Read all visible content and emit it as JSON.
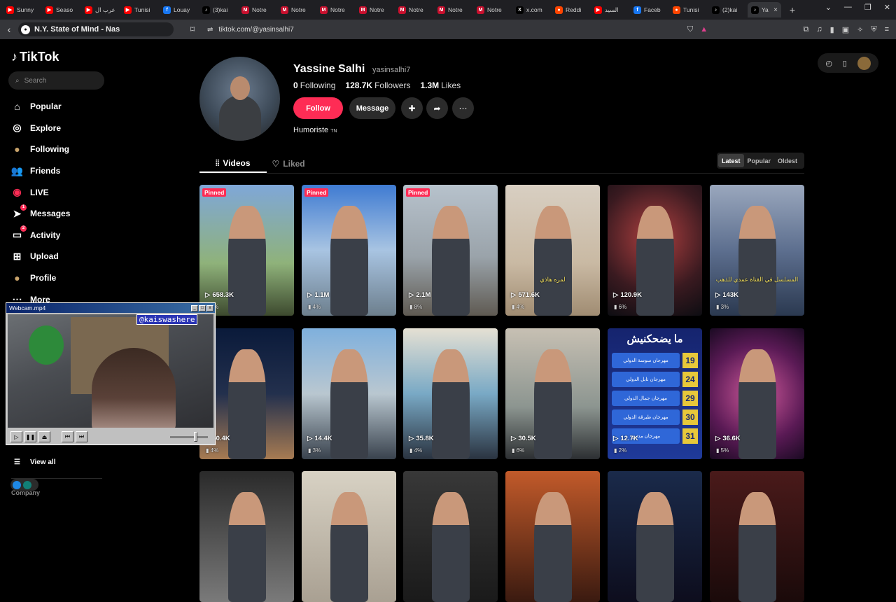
{
  "browser": {
    "tabs": [
      {
        "label": "Sunny",
        "color": "#ff0000",
        "glyph": "▶"
      },
      {
        "label": "Seaso",
        "color": "#ff0000",
        "glyph": "▶"
      },
      {
        "label": "عرب ال",
        "color": "#ff0000",
        "glyph": "▶"
      },
      {
        "label": "Tunisi",
        "color": "#ff0000",
        "glyph": "▶"
      },
      {
        "label": "Louay",
        "color": "#1877f2",
        "glyph": "f"
      },
      {
        "label": "(3)kai",
        "color": "#000000",
        "glyph": "♪"
      },
      {
        "label": "Notre",
        "color": "#c8102e",
        "glyph": "M"
      },
      {
        "label": "Notre",
        "color": "#c8102e",
        "glyph": "M"
      },
      {
        "label": "Notre",
        "color": "#c8102e",
        "glyph": "M"
      },
      {
        "label": "Notre",
        "color": "#c8102e",
        "glyph": "M"
      },
      {
        "label": "Notre",
        "color": "#c8102e",
        "glyph": "M"
      },
      {
        "label": "Notre",
        "color": "#c8102e",
        "glyph": "M"
      },
      {
        "label": "Notre",
        "color": "#c8102e",
        "glyph": "M"
      },
      {
        "label": "x.com",
        "color": "#000000",
        "glyph": "X"
      },
      {
        "label": "Reddi",
        "color": "#ff4500",
        "glyph": "●"
      },
      {
        "label": "السيد",
        "color": "#ff0000",
        "glyph": "▶"
      },
      {
        "label": "Faceb",
        "color": "#1877f2",
        "glyph": "f"
      },
      {
        "label": "Tunisi",
        "color": "#ff4500",
        "glyph": "●"
      },
      {
        "label": "(2)kai",
        "color": "#000000",
        "glyph": "♪"
      }
    ],
    "active_tab": "Ya",
    "media_title": "N.Y. State of Mind - Nas",
    "url": "tiktok.com/@yasinsalhi7"
  },
  "sidebar": {
    "logo": "TikTok",
    "search_placeholder": "Search",
    "items": [
      {
        "label": "Popular",
        "icon": "home-icon",
        "glyph": "⌂"
      },
      {
        "label": "Explore",
        "icon": "compass-icon",
        "glyph": "◎"
      },
      {
        "label": "Following",
        "icon": "following-avatar-icon",
        "glyph": "●"
      },
      {
        "label": "Friends",
        "icon": "friends-icon",
        "glyph": "👥"
      },
      {
        "label": "LIVE",
        "icon": "live-icon",
        "glyph": "◉"
      },
      {
        "label": "Messages",
        "icon": "paper-plane-icon",
        "glyph": "➤",
        "badge": "1"
      },
      {
        "label": "Activity",
        "icon": "inbox-icon",
        "glyph": "▭",
        "badge": "2"
      },
      {
        "label": "Upload",
        "icon": "plus-square-icon",
        "glyph": "⊞"
      },
      {
        "label": "Profile",
        "icon": "profile-avatar-icon",
        "glyph": "●"
      },
      {
        "label": "More",
        "icon": "more-icon",
        "glyph": "⋯"
      }
    ],
    "view_all": "View all",
    "company": "Company"
  },
  "webcam": {
    "title": "Webcam.mp4",
    "handle": "@kaiswashere"
  },
  "profile": {
    "name": "Yassine Salhi",
    "username": "yasinsalhi7",
    "following_count": "0",
    "following_label": "Following",
    "followers_count": "128.7K",
    "followers_label": "Followers",
    "likes_count": "1.3M",
    "likes_label": "Likes",
    "follow_label": "Follow",
    "message_label": "Message",
    "bio": "Humoriste",
    "bio_flag": "TN"
  },
  "tabs": {
    "videos": "Videos",
    "liked": "Liked"
  },
  "sort": {
    "latest": "Latest",
    "popular": "Popular",
    "oldest": "Oldest"
  },
  "videos": [
    {
      "views": "658.3K",
      "pct": "5%",
      "pinned": "Pinned",
      "bg": "linear-gradient(180deg,#7fa7d8 0%,#8fb27a 60%,#3d4a2f 100%)",
      "caption": ""
    },
    {
      "views": "1.1M",
      "pct": "4%",
      "pinned": "Pinned",
      "bg": "linear-gradient(180deg,#3f7bd2 0%,#a8c4e2 50%,#6d7f8d 100%)",
      "caption": ""
    },
    {
      "views": "2.1M",
      "pct": "8%",
      "pinned": "Pinned",
      "bg": "linear-gradient(180deg,#b7c2cc 0%,#9aa3aa 55%,#5f5a52 100%)",
      "caption": ""
    },
    {
      "views": "571.6K",
      "pct": "4%",
      "pinned": "",
      "bg": "linear-gradient(180deg,#d8cfc2 0%,#c9b9a3 60%,#a08c72 100%)",
      "caption": "لمره هاذي"
    },
    {
      "views": "120.9K",
      "pct": "6%",
      "pinned": "",
      "bg": "radial-gradient(circle at 50% 40%,#b04040 0%,#3a1a20 60%,#0d0d12 100%)",
      "caption": ""
    },
    {
      "views": "143K",
      "pct": "3%",
      "pinned": "",
      "bg": "linear-gradient(180deg,#9aa7bd 0%,#5d6f8f 50%,#2b3950 100%)",
      "caption": "المسلسل في القناة عمدي للذهب"
    },
    {
      "views": "50.4K",
      "pct": "4%",
      "pinned": "",
      "bg": "linear-gradient(180deg,#0a1a3a 0%,#23304d 50%,#a77b52 100%)",
      "caption": ""
    },
    {
      "views": "14.4K",
      "pct": "3%",
      "pinned": "",
      "bg": "linear-gradient(180deg,#7fb0dd 0%,#b9c7d0 50%,#39424d 100%)",
      "caption": ""
    },
    {
      "views": "35.8K",
      "pct": "4%",
      "pinned": "",
      "bg": "linear-gradient(180deg,#e5e0d3 0%,#79a9c5 50%,#2a3340 100%)",
      "caption": ""
    },
    {
      "views": "30.5K",
      "pct": "6%",
      "pinned": "",
      "bg": "linear-gradient(180deg,#c7c0b3 0%,#8c9590 60%,#2c2f32 100%)",
      "caption": ""
    },
    {
      "views": "12.7K",
      "pct": "2%",
      "pinned": "",
      "bg": "linear-gradient(180deg,#16246e 0%,#1f3a9a 100%)",
      "caption": "",
      "poster": true
    },
    {
      "views": "36.6K",
      "pct": "5%",
      "pinned": "",
      "bg": "radial-gradient(circle at 50% 50%,#d05a9b 0%,#5a1a55 60%,#1a0a22 100%)",
      "caption": ""
    },
    {
      "views": "",
      "pct": "",
      "pinned": "",
      "bg": "linear-gradient(180deg,#2a2a2a,#7a7a7a)",
      "caption": ""
    },
    {
      "views": "",
      "pct": "",
      "pinned": "",
      "bg": "linear-gradient(180deg,#d8d2c4,#a9a092)",
      "caption": ""
    },
    {
      "views": "",
      "pct": "",
      "pinned": "",
      "bg": "linear-gradient(180deg,#383838,#1a1a1a)",
      "caption": ""
    },
    {
      "views": "",
      "pct": "",
      "pinned": "",
      "bg": "linear-gradient(180deg,#c25a2a,#3a1a10)",
      "caption": ""
    },
    {
      "views": "",
      "pct": "",
      "pinned": "",
      "bg": "linear-gradient(180deg,#1a2a4a,#0d0d1d)",
      "caption": ""
    },
    {
      "views": "",
      "pct": "",
      "pinned": "",
      "bg": "linear-gradient(180deg,#4a1a1a,#1a0a0a)",
      "caption": ""
    }
  ],
  "poster": {
    "heading": "ما يضحكنيش",
    "rows": [
      {
        "label": "مهرجان سوسة الدولي",
        "num": "19"
      },
      {
        "label": "مهرجان نابل الدولي",
        "num": "24"
      },
      {
        "label": "مهرجان جمال الدولي",
        "num": "29"
      },
      {
        "label": "مهرجان طبرقة الدولي",
        "num": "30"
      },
      {
        "label": "مهرجان مدنين",
        "num": "31"
      }
    ]
  }
}
